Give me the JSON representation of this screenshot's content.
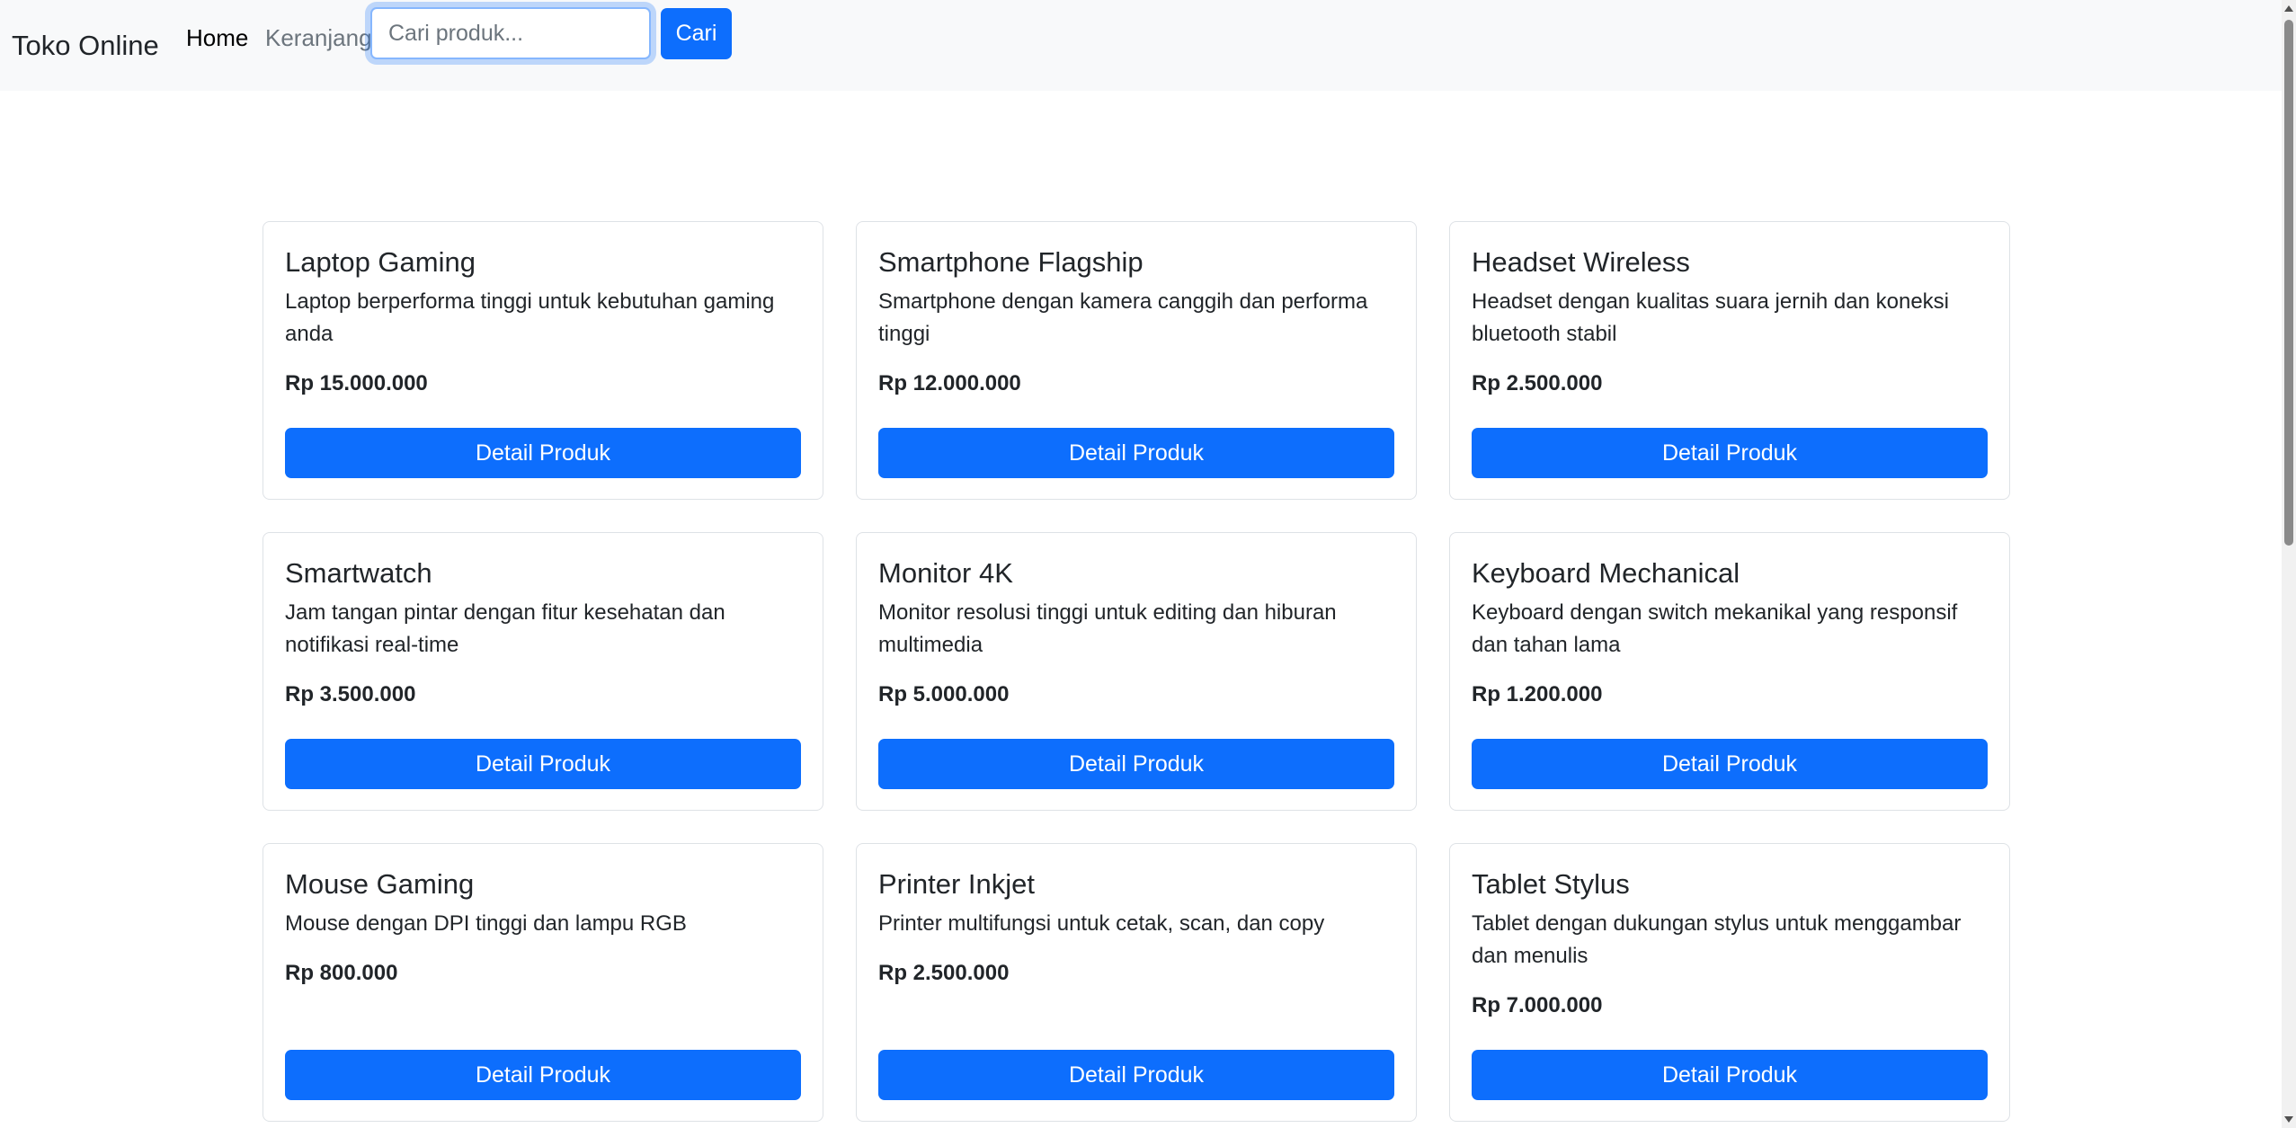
{
  "navbar": {
    "brand": "Toko Online",
    "links": [
      {
        "label": "Home",
        "active": true
      },
      {
        "label": "Keranjang",
        "active": false
      }
    ],
    "search": {
      "placeholder": "Cari produk...",
      "value": "",
      "button_label": "Cari"
    }
  },
  "products": [
    {
      "name": "Laptop Gaming",
      "description": "Laptop berperforma tinggi untuk kebutuhan gaming anda",
      "price": "Rp 15.000.000",
      "button_label": "Detail Produk"
    },
    {
      "name": "Smartphone Flagship",
      "description": "Smartphone dengan kamera canggih dan performa tinggi",
      "price": "Rp 12.000.000",
      "button_label": "Detail Produk"
    },
    {
      "name": "Headset Wireless",
      "description": "Headset dengan kualitas suara jernih dan koneksi bluetooth stabil",
      "price": "Rp 2.500.000",
      "button_label": "Detail Produk"
    },
    {
      "name": "Smartwatch",
      "description": "Jam tangan pintar dengan fitur kesehatan dan notifikasi real-time",
      "price": "Rp 3.500.000",
      "button_label": "Detail Produk"
    },
    {
      "name": "Monitor 4K",
      "description": "Monitor resolusi tinggi untuk editing dan hiburan multimedia",
      "price": "Rp 5.000.000",
      "button_label": "Detail Produk"
    },
    {
      "name": "Keyboard Mechanical",
      "description": "Keyboard dengan switch mekanikal yang responsif dan tahan lama",
      "price": "Rp 1.200.000",
      "button_label": "Detail Produk"
    },
    {
      "name": "Mouse Gaming",
      "description": "Mouse dengan DPI tinggi dan lampu RGB",
      "price": "Rp 800.000",
      "button_label": "Detail Produk"
    },
    {
      "name": "Printer Inkjet",
      "description": "Printer multifungsi untuk cetak, scan, dan copy",
      "price": "Rp 2.500.000",
      "button_label": "Detail Produk"
    },
    {
      "name": "Tablet Stylus",
      "description": "Tablet dengan dukungan stylus untuk menggambar dan menulis",
      "price": "Rp 7.000.000",
      "button_label": "Detail Produk"
    }
  ],
  "colors": {
    "primary": "#0d6efd",
    "navbar_bg": "#f8f9fa",
    "text": "#212529",
    "muted": "#6c757d",
    "border": "#dee2e6"
  }
}
